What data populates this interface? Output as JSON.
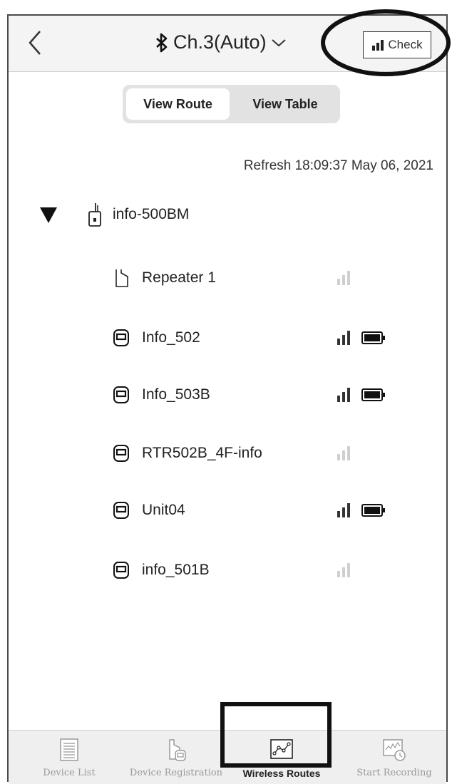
{
  "header": {
    "channel_title": "Ch.3(Auto)",
    "check_label": "Check"
  },
  "segmented": {
    "view_route": "View Route",
    "view_table": "View Table"
  },
  "refresh_text": "Refresh 18:09:37 May 06, 2021",
  "root": {
    "label": "info-500BM"
  },
  "devices": [
    {
      "label": "Repeater 1",
      "type": "repeater",
      "signal_active": false,
      "battery": false
    },
    {
      "label": "Info_502",
      "type": "logger",
      "signal_active": true,
      "battery": true
    },
    {
      "label": "Info_503B",
      "type": "logger",
      "signal_active": true,
      "battery": true
    },
    {
      "label": "RTR502B_4F-info",
      "type": "logger",
      "signal_active": false,
      "battery": false
    },
    {
      "label": "Unit04",
      "type": "logger",
      "signal_active": true,
      "battery": true
    },
    {
      "label": "info_501B",
      "type": "logger",
      "signal_active": false,
      "battery": false
    }
  ],
  "tabs": [
    {
      "label": "Device List",
      "icon": "list-icon",
      "active": false
    },
    {
      "label": "Device Registration",
      "icon": "device-registration-icon",
      "active": false
    },
    {
      "label": "Wireless Routes",
      "icon": "wireless-routes-icon",
      "active": true
    },
    {
      "label": "Start Recording",
      "icon": "start-recording-icon",
      "active": false
    }
  ],
  "colors": {
    "signal_active": "#333333",
    "signal_inactive": "#cfcfcf",
    "header_bg": "#f4f4f4",
    "tabbar_bg": "#efefef"
  }
}
